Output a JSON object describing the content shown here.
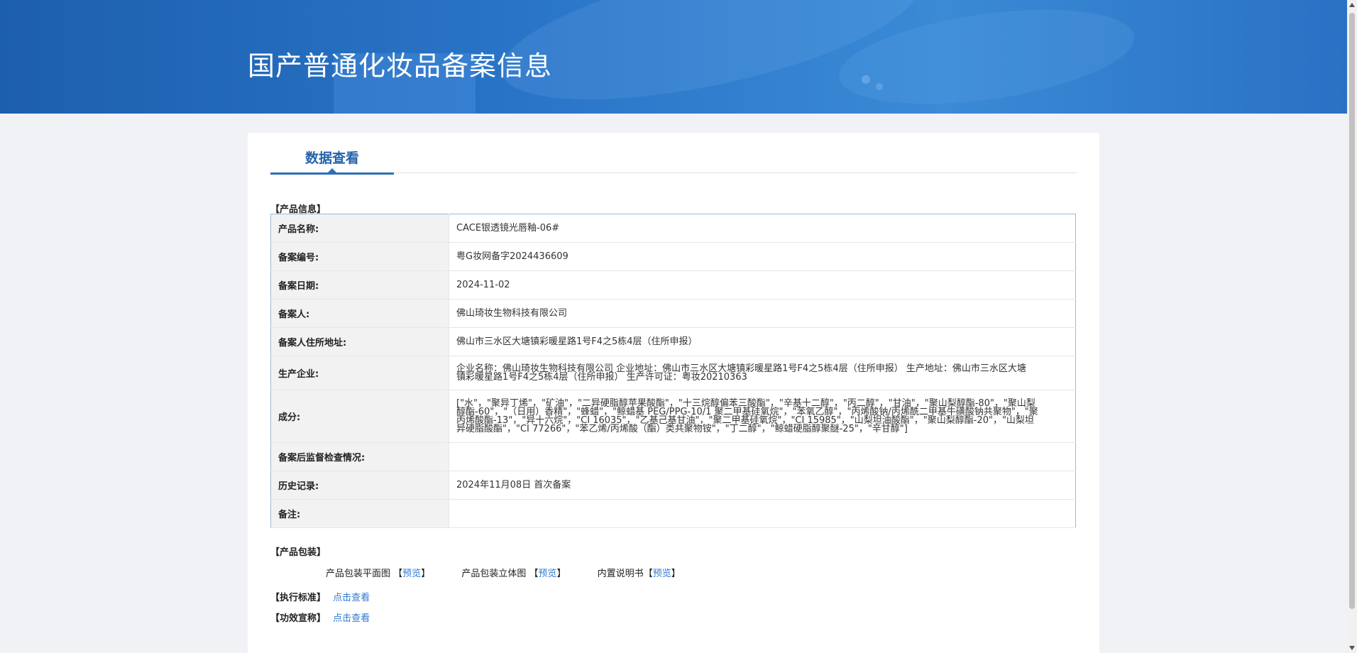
{
  "banner": {
    "title": "国产普通化妆品备案信息"
  },
  "tab": {
    "label": "数据查看"
  },
  "product_section": {
    "title": "【产品信息】"
  },
  "rows": [
    {
      "label": "产品名称:",
      "value": "CACE银透镜光唇釉-06#"
    },
    {
      "label": "备案编号:",
      "value": "粤G妆网备字2024436609"
    },
    {
      "label": "备案日期:",
      "value": "2024-11-02"
    },
    {
      "label": "备案人:",
      "value": "佛山琦妆生物科技有限公司"
    },
    {
      "label": "备案人住所地址:",
      "value": "佛山市三水区大塘镇彩暖星路1号F4之5栋4层（住所申报）"
    },
    {
      "label": "生产企业:",
      "value": "企业名称：佛山琦妆生物科技有限公司 企业地址：佛山市三水区大塘镇彩暖星路1号F4之5栋4层（住所申报） 生产地址：佛山市三水区大塘镇彩暖星路1号F4之5栋4层（住所申报） 生产许可证：粤妆20210363"
    },
    {
      "label": "成分:",
      "value": "[\"水\"，\"聚异丁烯\"，\"矿油\"，\"二异硬脂醇苹果酸酯\"，\"十三烷醇偏苯三酸酯\"，\"辛基十二醇\"，\"丙二醇\"，\"甘油\"，\"聚山梨醇酯-80\"，\"聚山梨醇酯-60\"，\"（日用）香精\"，\"蜂蜡\"，\"鲸蜡基 PEG/PPG-10/1 聚二甲基硅氧烷\"，\"苯氧乙醇\"，\"丙烯酸钠/丙烯酰二甲基牛磺酸钠共聚物\"，\"聚丙烯酸酯-13\"，\"异十六烷\"，\"CI 16035\"，\"乙基己基甘油\"，\"聚二甲基硅氧烷\"，\"CI 15985\"，\"山梨坦油酸酯\"，\"聚山梨醇酯-20\"，\"山梨坦异硬脂酸酯\"，\"CI 77266\"，\"苯乙烯/丙烯酸（酯）类共聚物铵\"，\"丁二醇\"，\"鲸蜡硬脂醇聚醚-25\"，\"辛甘醇\"]"
    },
    {
      "label": "备案后监督检查情况:",
      "value": ""
    },
    {
      "label": "历史记录:",
      "value": "2024年11月08日 首次备案"
    },
    {
      "label": "备注:",
      "value": ""
    }
  ],
  "package_section": {
    "title": "【产品包装】",
    "items": [
      {
        "label": "产品包装平面图",
        "open": "【",
        "link": "预览",
        "close": "】"
      },
      {
        "label": "产品包装立体图",
        "open": "【",
        "link": "预览",
        "close": "】"
      },
      {
        "label": "内置说明书",
        "open": "【",
        "link": "预览",
        "close": "】"
      }
    ]
  },
  "standard": {
    "label": "【执行标准】",
    "link": "点击查看"
  },
  "efficacy": {
    "label": "【功效宣称】",
    "link": "点击查看"
  }
}
